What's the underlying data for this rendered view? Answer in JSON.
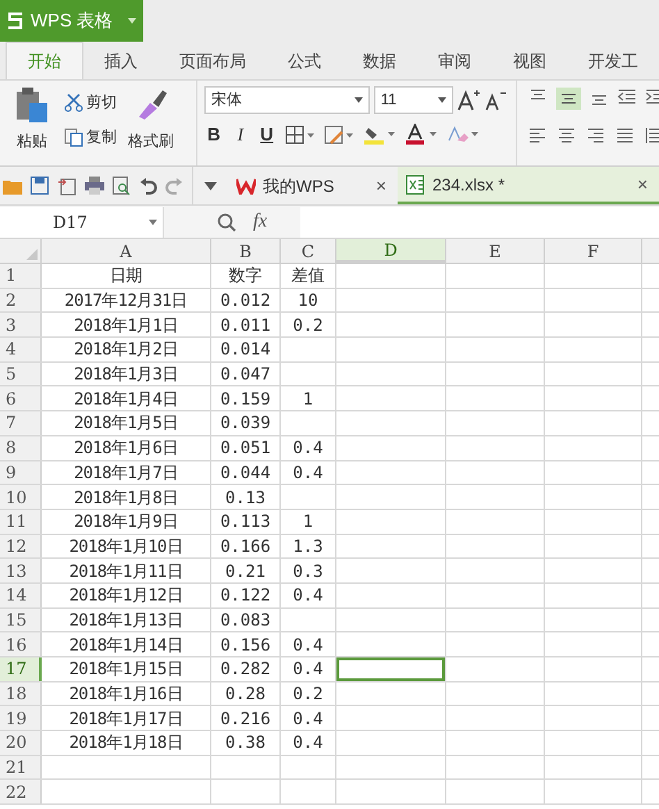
{
  "app_button": {
    "label": "WPS 表格"
  },
  "tabs": [
    {
      "label": "开始",
      "selected": true
    },
    {
      "label": "插入",
      "selected": false
    },
    {
      "label": "页面布局",
      "selected": false
    },
    {
      "label": "公式",
      "selected": false
    },
    {
      "label": "数据",
      "selected": false
    },
    {
      "label": "审阅",
      "selected": false
    },
    {
      "label": "视图",
      "selected": false
    },
    {
      "label": "开发工",
      "selected": false
    }
  ],
  "clipboard": {
    "paste": "粘贴",
    "cut": "剪切",
    "copy": "复制",
    "format_painter": "格式刷"
  },
  "font": {
    "name": "宋体",
    "size": "11",
    "bold": "B",
    "italic": "I",
    "underline": "U"
  },
  "doc_tabs": [
    {
      "label": "我的WPS",
      "close": "×",
      "kind": "home",
      "selected": false
    },
    {
      "label": "234.xlsx *",
      "close": "×",
      "kind": "sheet",
      "selected": true
    }
  ],
  "formula_bar": {
    "name_box": "D17",
    "fx": "fx"
  },
  "columns": [
    {
      "label": "A",
      "selected": false
    },
    {
      "label": "B",
      "selected": false
    },
    {
      "label": "C",
      "selected": false
    },
    {
      "label": "D",
      "selected": true
    },
    {
      "label": "E",
      "selected": false
    },
    {
      "label": "F",
      "selected": false
    }
  ],
  "rows": [
    {
      "number": "1",
      "a": "日期",
      "b": "数字",
      "c": "差值",
      "selected": false
    },
    {
      "number": "2",
      "a": "2017年12月31日",
      "b": "0.012",
      "c": "10",
      "selected": false
    },
    {
      "number": "3",
      "a": "2018年1月1日",
      "b": "0.011",
      "c": "0.2",
      "selected": false
    },
    {
      "number": "4",
      "a": "2018年1月2日",
      "b": "0.014",
      "selected": false
    },
    {
      "number": "5",
      "a": "2018年1月3日",
      "b": "0.047",
      "selected": false
    },
    {
      "number": "6",
      "a": "2018年1月4日",
      "b": "0.159",
      "c": "1",
      "selected": false
    },
    {
      "number": "7",
      "a": "2018年1月5日",
      "b": "0.039",
      "selected": false
    },
    {
      "number": "8",
      "a": "2018年1月6日",
      "b": "0.051",
      "c": "0.4",
      "selected": false
    },
    {
      "number": "9",
      "a": "2018年1月7日",
      "b": "0.044",
      "c": "0.4",
      "selected": false
    },
    {
      "number": "10",
      "a": "2018年1月8日",
      "b": "0.13",
      "selected": false
    },
    {
      "number": "11",
      "a": "2018年1月9日",
      "b": "0.113",
      "c": "1",
      "selected": false
    },
    {
      "number": "12",
      "a": "2018年1月10日",
      "b": "0.166",
      "c": "1.3",
      "selected": false
    },
    {
      "number": "13",
      "a": "2018年1月11日",
      "b": "0.21",
      "c": "0.3",
      "selected": false
    },
    {
      "number": "14",
      "a": "2018年1月12日",
      "b": "0.122",
      "c": "0.4",
      "selected": false
    },
    {
      "number": "15",
      "a": "2018年1月13日",
      "b": "0.083",
      "selected": false
    },
    {
      "number": "16",
      "a": "2018年1月14日",
      "b": "0.156",
      "c": "0.4",
      "selected": false
    },
    {
      "number": "17",
      "a": "2018年1月15日",
      "b": "0.282",
      "c": "0.4",
      "selected": true
    },
    {
      "number": "18",
      "a": "2018年1月16日",
      "b": "0.28",
      "c": "0.2",
      "selected": false
    },
    {
      "number": "19",
      "a": "2018年1月17日",
      "b": "0.216",
      "c": "0.4",
      "selected": false
    },
    {
      "number": "20",
      "a": "2018年1月18日",
      "b": "0.38",
      "c": "0.4",
      "selected": false
    },
    {
      "number": "21",
      "selected": false
    },
    {
      "number": "22",
      "selected": false
    }
  ]
}
